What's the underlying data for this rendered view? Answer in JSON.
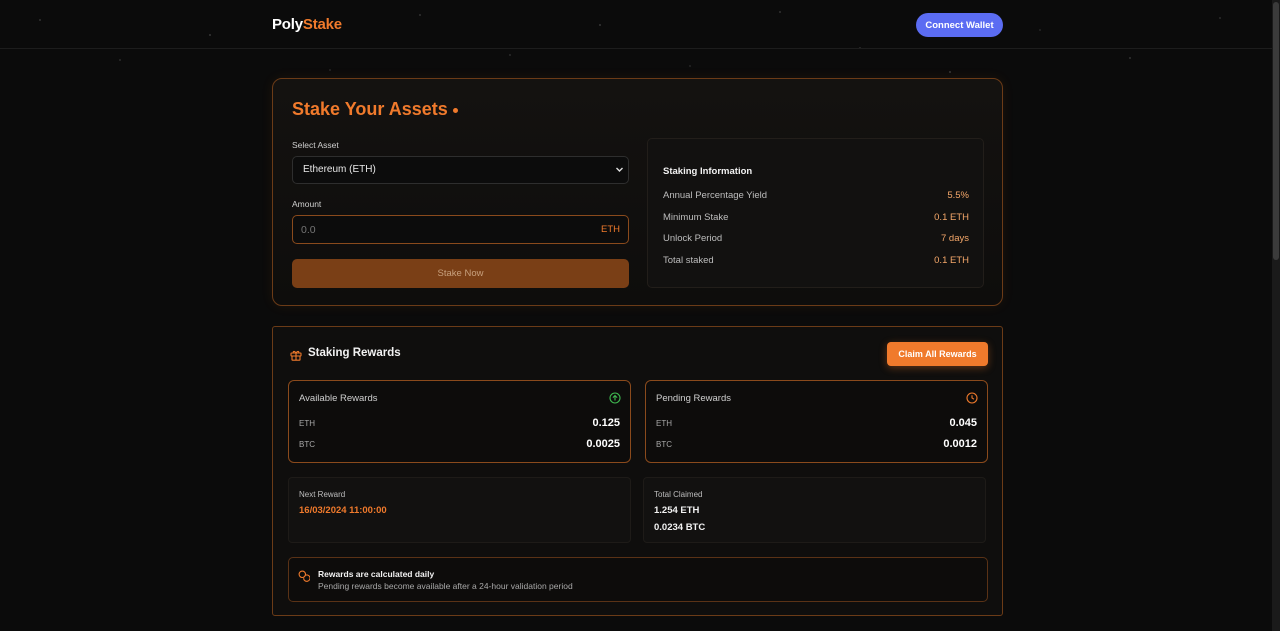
{
  "header": {
    "logo_part1": "Poly",
    "logo_part2": "Stake",
    "connect_label": "Connect Wallet"
  },
  "stake": {
    "title": "Stake Your Assets",
    "asset_label": "Select Asset",
    "asset_selected": "Ethereum (ETH)",
    "amount_label": "Amount",
    "amount_placeholder": "0.0",
    "amount_unit": "ETH",
    "stake_button": "Stake Now",
    "info": {
      "title": "Staking Information",
      "rows": [
        {
          "label": "Annual Percentage Yield",
          "value": "5.5%"
        },
        {
          "label": "Minimum Stake",
          "value": "0.1 ETH"
        },
        {
          "label": "Unlock Period",
          "value": "7 days"
        },
        {
          "label": "Total staked",
          "value": "0.1 ETH"
        }
      ]
    }
  },
  "rewards": {
    "title": "Staking Rewards",
    "claim_button": "Claim All Rewards",
    "available": {
      "title": "Available Rewards",
      "icon": "arrow-up-circle-icon",
      "rows": [
        {
          "asset": "ETH",
          "value": "0.125"
        },
        {
          "asset": "BTC",
          "value": "0.0025"
        }
      ]
    },
    "pending": {
      "title": "Pending Rewards",
      "icon": "clock-icon",
      "rows": [
        {
          "asset": "ETH",
          "value": "0.045"
        },
        {
          "asset": "BTC",
          "value": "0.0012"
        }
      ]
    },
    "next_reward": {
      "title": "Next Reward",
      "value": "16/03/2024 11:00:00"
    },
    "total_claimed": {
      "title": "Total Claimed",
      "eth": "1.254 ETH",
      "btc": "0.0234 BTC"
    },
    "note": {
      "heading": "Rewards are calculated daily",
      "text": "Pending rewards become available after a 24-hour validation period"
    }
  },
  "colors": {
    "accent": "#f07a2c",
    "wallet_button": "#5b6cf2",
    "success": "#3fb950",
    "background": "#0b0b0b"
  }
}
